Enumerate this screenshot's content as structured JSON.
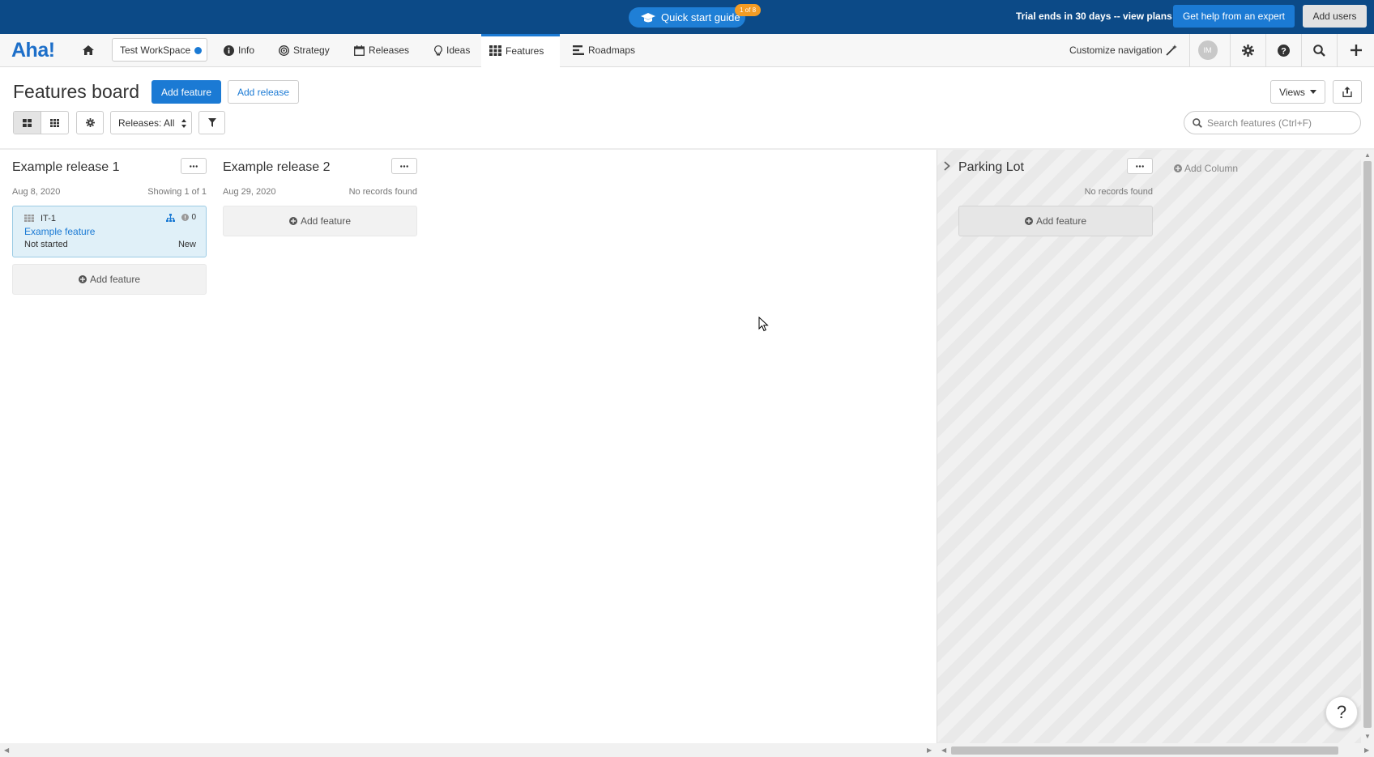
{
  "banner": {
    "quick_start_label": "Quick start guide",
    "quick_start_badge": "1 of 8",
    "trial_text": "Trial ends in 30 days -- view plans",
    "help_button": "Get help from an expert",
    "add_users_button": "Add users"
  },
  "nav": {
    "logo": "Aha!",
    "workspace": "Test WorkSpace",
    "items": [
      {
        "label": "Info",
        "icon": "info-icon"
      },
      {
        "label": "Strategy",
        "icon": "target-icon"
      },
      {
        "label": "Releases",
        "icon": "calendar-icon"
      },
      {
        "label": "Ideas",
        "icon": "lightbulb-icon"
      },
      {
        "label": "Features",
        "icon": "grid-icon",
        "active": true
      },
      {
        "label": "Roadmaps",
        "icon": "roadmap-icon"
      }
    ],
    "customize_label": "Customize navigation",
    "avatar_initials": "IM"
  },
  "page": {
    "title": "Features board",
    "add_feature_button": "Add feature",
    "add_release_button": "Add release",
    "views_button": "Views",
    "releases_filter": "Releases: All",
    "search_placeholder": "Search features (Ctrl+F)"
  },
  "board": {
    "columns": [
      {
        "title": "Example release 1",
        "date": "Aug 8, 2020",
        "count_text": "Showing 1 of 1",
        "add_feature": "Add feature",
        "cards": [
          {
            "id": "IT-1",
            "title": "Example feature",
            "status": "Not started",
            "workflow": "New",
            "comments": "0"
          }
        ]
      },
      {
        "title": "Example release 2",
        "date": "Aug 29, 2020",
        "count_text": "No records found",
        "add_feature": "Add feature",
        "cards": []
      }
    ],
    "parking_lot": {
      "title": "Parking Lot",
      "count_text": "No records found",
      "add_feature": "Add feature"
    },
    "add_column": "Add Column"
  },
  "help_float": "?",
  "colors": {
    "banner": "#0c4a87",
    "accent": "#1b7ad4",
    "badge": "#f39c24",
    "card_bg": "#e0f0f8"
  }
}
